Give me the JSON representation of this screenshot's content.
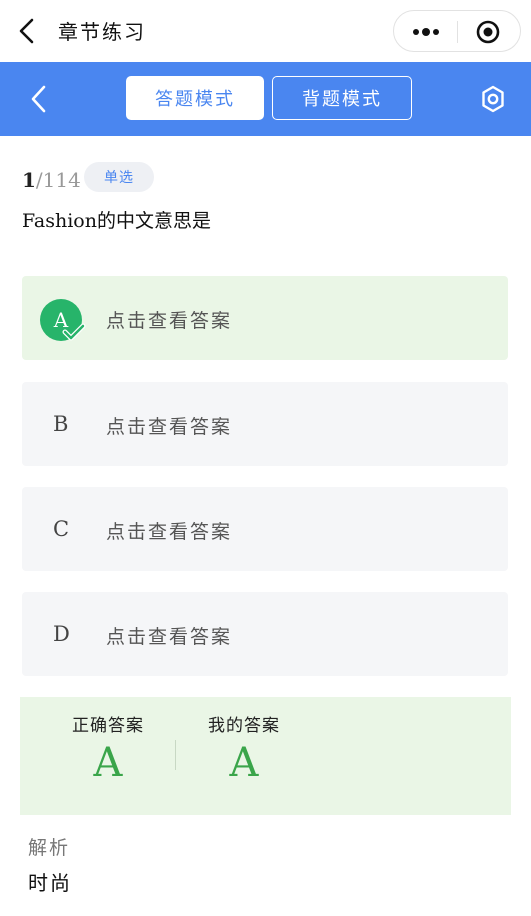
{
  "window": {
    "title": "章节练习"
  },
  "header": {
    "tabs": [
      {
        "label": "答题模式",
        "active": true
      },
      {
        "label": "背题模式",
        "active": false
      }
    ]
  },
  "question": {
    "current": "1",
    "total": "/114",
    "type": "单选",
    "text": "Fashion的中文意思是"
  },
  "options": [
    {
      "letter": "A",
      "text": "点击查看答案",
      "state": "correct"
    },
    {
      "letter": "B",
      "text": "点击查看答案",
      "state": "none"
    },
    {
      "letter": "C",
      "text": "点击查看答案",
      "state": "none"
    },
    {
      "letter": "D",
      "text": "点击查看答案",
      "state": "none"
    }
  ],
  "answer": {
    "correct_label": "正确答案",
    "correct_value": "A",
    "mine_label": "我的答案",
    "mine_value": "A"
  },
  "analysis": {
    "label": "解析",
    "text": "时尚"
  },
  "colors": {
    "brand": "#4a86f0",
    "correct": "#27b46a",
    "correct_bg": "#eaf6e6"
  },
  "icons": [
    "back-icon",
    "more-icon",
    "target-icon",
    "gear-icon",
    "check-icon"
  ]
}
